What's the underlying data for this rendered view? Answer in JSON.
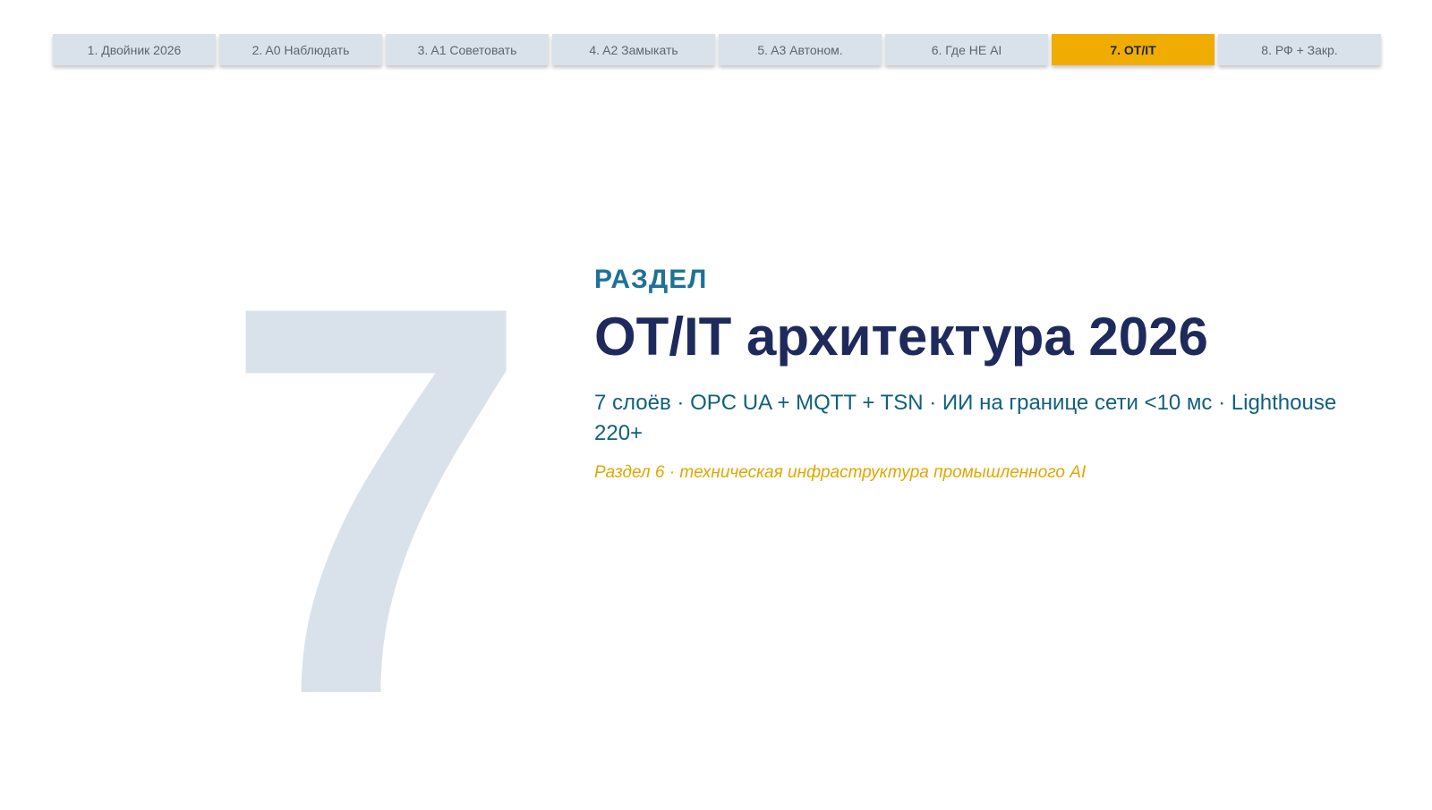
{
  "nav": {
    "tabs": [
      {
        "label": "1. Двойник 2026"
      },
      {
        "label": "2. A0 Наблюдать"
      },
      {
        "label": "3. A1 Советовать"
      },
      {
        "label": "4. A2 Замыкать"
      },
      {
        "label": "5. A3 Автоном."
      },
      {
        "label": "6. Где НЕ AI"
      },
      {
        "label": "7. OT/IT"
      },
      {
        "label": "8. РФ + Закр."
      }
    ],
    "active_index": 6,
    "active_color": "#f0ad00"
  },
  "section": {
    "number": "7",
    "kicker": "РАЗДЕЛ",
    "title": "OT/IT архитектура 2026",
    "subtitle": "7 слоёв · OPC UA + MQTT + TSN · ИИ на границе сети <10 мс · Lighthouse 220+",
    "note": "Раздел 6 · техническая инфраструктура промышленного AI"
  }
}
